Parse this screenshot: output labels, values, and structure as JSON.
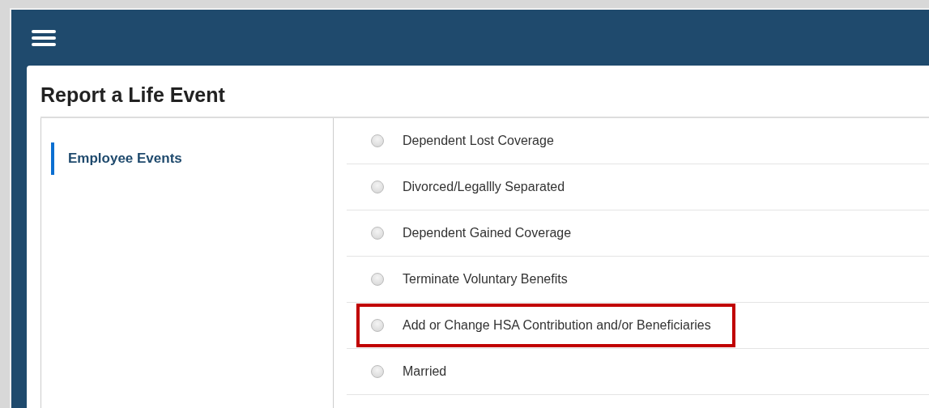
{
  "title": "Report a Life Event",
  "sidebar": {
    "items": [
      {
        "label": "Employee Events",
        "selected": true
      }
    ]
  },
  "events": [
    {
      "label": "Dependent Lost Coverage",
      "selected": false,
      "highlighted": false
    },
    {
      "label": "Divorced/Legallly Separated",
      "selected": false,
      "highlighted": false
    },
    {
      "label": "Dependent Gained Coverage",
      "selected": false,
      "highlighted": false
    },
    {
      "label": "Terminate Voluntary Benefits",
      "selected": false,
      "highlighted": false
    },
    {
      "label": "Add or Change HSA Contribution and/or Beneficiaries",
      "selected": false,
      "highlighted": true
    },
    {
      "label": "Married",
      "selected": false,
      "highlighted": false
    }
  ]
}
